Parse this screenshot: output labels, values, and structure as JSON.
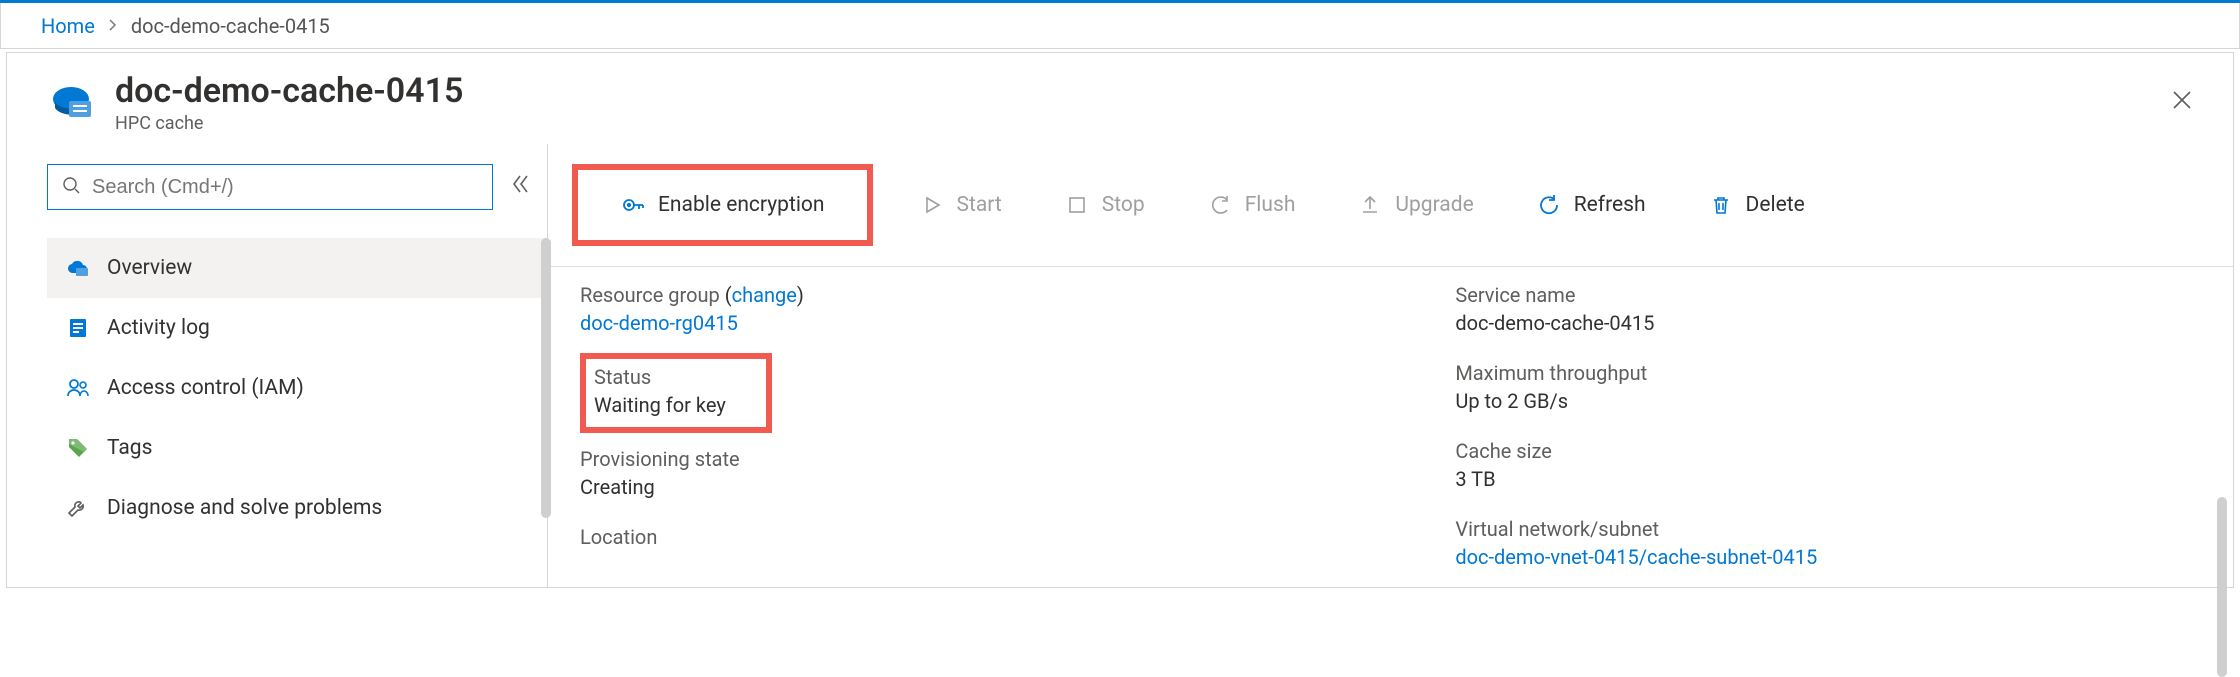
{
  "breadcrumb": {
    "home": "Home",
    "current": "doc-demo-cache-0415"
  },
  "header": {
    "title": "doc-demo-cache-0415",
    "subtitle": "HPC cache"
  },
  "sidebar": {
    "search_placeholder": "Search (Cmd+/)",
    "items": [
      {
        "label": "Overview",
        "icon": "cloud",
        "selected": true
      },
      {
        "label": "Activity log",
        "icon": "log",
        "selected": false
      },
      {
        "label": "Access control (IAM)",
        "icon": "people",
        "selected": false
      },
      {
        "label": "Tags",
        "icon": "tag",
        "selected": false
      },
      {
        "label": "Diagnose and solve problems",
        "icon": "wrench",
        "selected": false
      }
    ]
  },
  "toolbar": {
    "enable_encryption": "Enable encryption",
    "start": "Start",
    "stop": "Stop",
    "flush": "Flush",
    "upgrade": "Upgrade",
    "refresh": "Refresh",
    "delete": "Delete"
  },
  "details": {
    "left": {
      "resource_group_label": "Resource group",
      "resource_group_change": "change",
      "resource_group_value": "doc-demo-rg0415",
      "status_label": "Status",
      "status_value": "Waiting for key",
      "provisioning_label": "Provisioning state",
      "provisioning_value": "Creating",
      "location_label": "Location"
    },
    "right": {
      "service_name_label": "Service name",
      "service_name_value": "doc-demo-cache-0415",
      "max_throughput_label": "Maximum throughput",
      "max_throughput_value": "Up to 2 GB/s",
      "cache_size_label": "Cache size",
      "cache_size_value": "3 TB",
      "vnet_label": "Virtual network/subnet",
      "vnet_value": "doc-demo-vnet-0415/cache-subnet-0415"
    }
  }
}
